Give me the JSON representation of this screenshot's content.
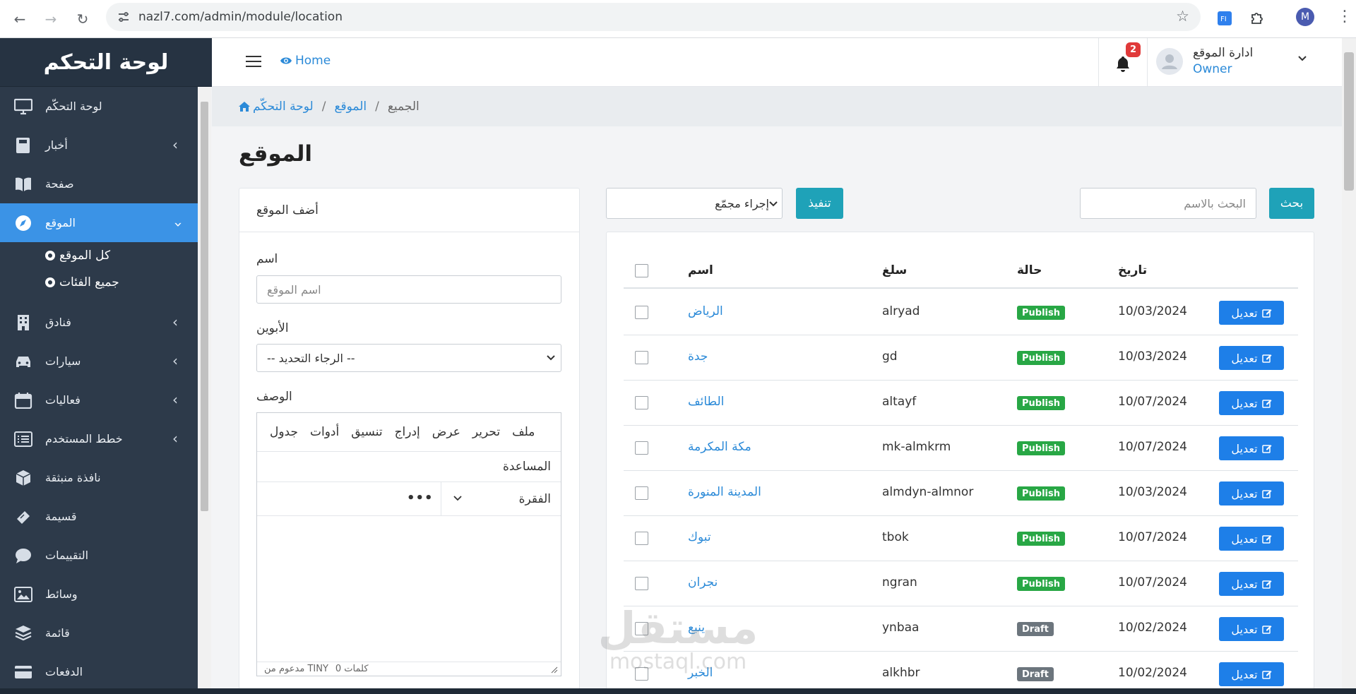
{
  "browser": {
    "url": "nazl7.com/admin/module/location",
    "profile_initial": "M"
  },
  "sidebar": {
    "brand": "لوحة التحكم",
    "items": [
      {
        "label": "لوحة التحكّم",
        "icon": "monitor-icon",
        "chevron": false,
        "active": false
      },
      {
        "label": "أخبار",
        "icon": "book-icon",
        "chevron": true,
        "active": false
      },
      {
        "label": "صفحة",
        "icon": "book-open-icon",
        "chevron": false,
        "active": false
      },
      {
        "label": "الموقع",
        "icon": "compass-icon",
        "chevron": true,
        "active": true
      },
      {
        "label": "فنادق",
        "icon": "building-icon",
        "chevron": true,
        "active": false
      },
      {
        "label": "سيارات",
        "icon": "car-icon",
        "chevron": true,
        "active": false
      },
      {
        "label": "فعاليات",
        "icon": "calendar-icon",
        "chevron": true,
        "active": false
      },
      {
        "label": "خطط المستخدم",
        "icon": "list-icon",
        "chevron": true,
        "active": false
      },
      {
        "label": "نافذة منبثقة",
        "icon": "cube-icon",
        "chevron": false,
        "active": false
      },
      {
        "label": "قسيمة",
        "icon": "ticket-icon",
        "chevron": false,
        "active": false
      },
      {
        "label": "التقييمات",
        "icon": "comment-icon",
        "chevron": false,
        "active": false
      },
      {
        "label": "وسائط",
        "icon": "image-icon",
        "chevron": false,
        "active": false
      },
      {
        "label": "قائمة",
        "icon": "layers-icon",
        "chevron": false,
        "active": false
      },
      {
        "label": "الدفعات",
        "icon": "credit-card-icon",
        "chevron": false,
        "active": false
      }
    ],
    "subitems": [
      "كل الموقع",
      "جميع الفئات"
    ]
  },
  "topbar": {
    "home_label": "Home",
    "notification_count": "2",
    "user_name": "ادارة الموقع",
    "user_role": "Owner"
  },
  "breadcrumb": {
    "home": "لوحة التحكّم",
    "section": "الموقع",
    "current": "الجميع"
  },
  "page_title": "الموقع",
  "form": {
    "title": "أضف الموقع",
    "name_label": "اسم",
    "name_placeholder": "اسم الموقع",
    "parent_label": "الأبوين",
    "parent_value": "-- الرجاء التحديد --",
    "desc_label": "الوصف",
    "editor_menu": [
      "ملف",
      "تحرير",
      "عرض",
      "إدراج",
      "تنسيق",
      "أدوات",
      "جدول"
    ],
    "editor_help": "المساعدة",
    "editor_format": "الفقرة",
    "editor_more": "•••",
    "editor_words": "0 كلمات",
    "editor_powered": "مدعوم من TINY"
  },
  "toolbar": {
    "bulk_action": "إجراء مجمّع",
    "run": "تنفيذ",
    "search_placeholder": "البحث بالاسم",
    "search": "بحث"
  },
  "table": {
    "headers": {
      "name": "اسم",
      "slug": "سلغ",
      "status": "حالة",
      "date": "تاريخ"
    },
    "edit_label": "تعديل",
    "rows": [
      {
        "name": "الرياض",
        "slug": "alryad",
        "status": "Publish",
        "date": "10/03/2024"
      },
      {
        "name": "جدة",
        "slug": "gd",
        "status": "Publish",
        "date": "10/03/2024"
      },
      {
        "name": "الطائف",
        "slug": "altayf",
        "status": "Publish",
        "date": "10/07/2024"
      },
      {
        "name": "مكة المكرمة",
        "slug": "mk-almkrm",
        "status": "Publish",
        "date": "10/07/2024"
      },
      {
        "name": "المدينة المنورة",
        "slug": "almdyn-almnor",
        "status": "Publish",
        "date": "10/03/2024"
      },
      {
        "name": "تبوك",
        "slug": "tbok",
        "status": "Publish",
        "date": "10/07/2024"
      },
      {
        "name": "نجران",
        "slug": "ngran",
        "status": "Publish",
        "date": "10/07/2024"
      },
      {
        "name": "ينبع",
        "slug": "ynbaa",
        "status": "Draft",
        "date": "10/02/2024"
      },
      {
        "name": "الخبر",
        "slug": "alkhbr",
        "status": "Draft",
        "date": "10/02/2024"
      }
    ]
  },
  "watermark": {
    "arabic": "مستقل",
    "latin": "mostaql.com"
  },
  "colors": {
    "publish": "#28a745",
    "draft": "#6c757d",
    "accent": "#3b93e6",
    "info": "#1fa2b8",
    "primary": "#1e7fe8"
  }
}
